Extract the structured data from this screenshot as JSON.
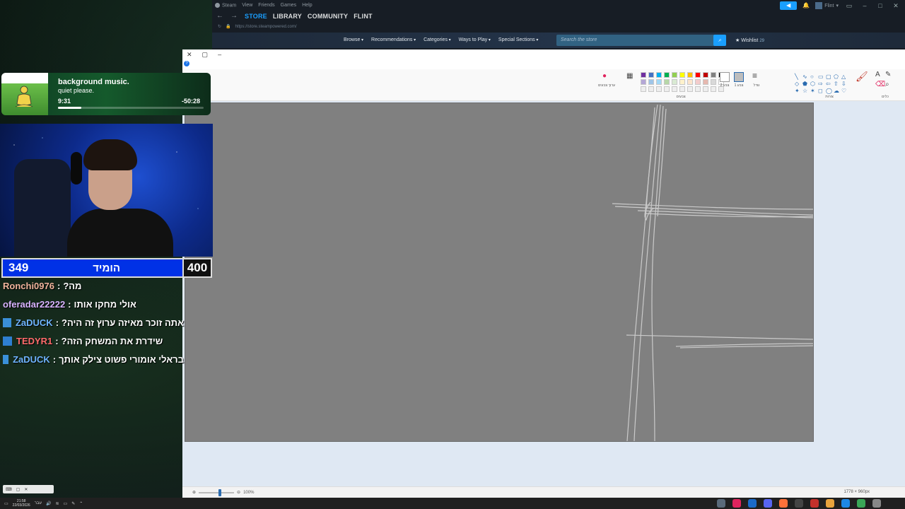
{
  "steam": {
    "menu": [
      "Steam",
      "View",
      "Friends",
      "Games",
      "Help"
    ],
    "nav": [
      {
        "label": "STORE",
        "active": true
      },
      {
        "label": "LIBRARY",
        "active": false
      },
      {
        "label": "COMMUNITY",
        "active": false
      },
      {
        "label": "FLINT",
        "active": false
      }
    ],
    "url": "https://store.steampowered.com/",
    "username": "Flint",
    "store_menu": [
      "Browse",
      "Recommendations",
      "Categories",
      "Ways to Play",
      "Special Sections"
    ],
    "search_placeholder": "Search the store",
    "wishlist_label": "Wishlist",
    "wishlist_count": "29"
  },
  "paint": {
    "colors": [
      "#7030a0",
      "#4472c4",
      "#00b0f0",
      "#00b050",
      "#92d050",
      "#ffff00",
      "#ffc000",
      "#ff0000",
      "#c00000",
      "#808080",
      "#000000",
      "#b4a7d6",
      "#9fc5e8",
      "#a2d9f7",
      "#b6d7a8",
      "#d9ead3",
      "#fff2cc",
      "#fce5cd",
      "#f4cccc",
      "#e6b8af",
      "#d9d9d9",
      "#ffffff",
      "#eeeeee",
      "#eeeeee",
      "#eeeeee",
      "#eeeeee",
      "#eeeeee",
      "#eeeeee",
      "#eeeeee",
      "#eeeeee",
      "#eeeeee",
      "#eeeeee",
      "#eeeeee"
    ],
    "canvas_color": "#808080",
    "group_colors": "צבעים",
    "group_shapes": "צורות",
    "group_tools": "כלים",
    "color1_label": "צבע 1",
    "color2_label": "צבע 2",
    "edit_colors_label": "ערוך צבעים",
    "size_label": "גודל",
    "zoom": "100%",
    "canvas_size": "1778 × 960px"
  },
  "music": {
    "title": "background music.",
    "subtitle": "quiet please.",
    "elapsed": "9:31",
    "remaining": "-50:28",
    "progress": 0.16
  },
  "counter": {
    "left_value": "349",
    "label": "הומיד",
    "right_value": "400"
  },
  "chat": [
    {
      "user": "Ronchi0976",
      "color": "#f0b49c",
      "badge": "",
      "message": "מה?"
    },
    {
      "user": "oferadar22222",
      "color": "#d8b4ff",
      "badge": "",
      "message": "אולי מחקו אותו"
    },
    {
      "user": "ZaDUCK",
      "color": "#6fb4ff",
      "badge": "#3a8fd8",
      "message": "אתה זוכר מאיזה ערוץ זה היה?"
    },
    {
      "user": "TEDYR1",
      "color": "#ff6b6b",
      "badge": "#2e7fd1",
      "message": "שידרת את המשחק הזה?"
    },
    {
      "user": "ZaDUCK",
      "color": "#6fb4ff",
      "badge": "#3a8fd8",
      "message": "בראלי אומורי פשוט צילק אותך"
    }
  ],
  "taskbar": {
    "time": "21:58",
    "date": "22/03/2026",
    "lang": "עבר",
    "app_colors": [
      "#5a6a7a",
      "#e0245e",
      "#1b6ac9",
      "#5865f2",
      "#ff7139",
      "#444",
      "#c4302b",
      "#e8a33d",
      "#1e88e5",
      "#3aa757",
      "#888"
    ]
  }
}
